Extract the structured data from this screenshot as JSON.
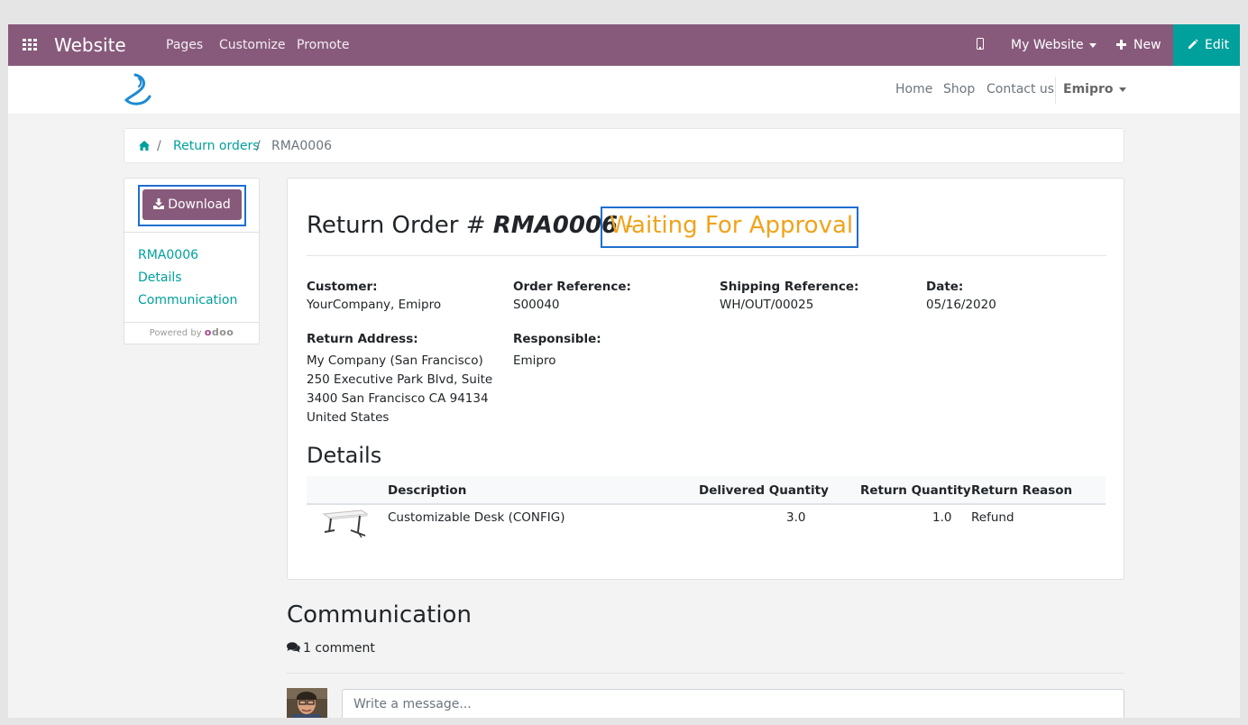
{
  "topbar": {
    "app_title": "Website",
    "menu": [
      "Pages",
      "Customize",
      "Promote"
    ],
    "website_selector": "My Website",
    "new_label": "New",
    "edit_label": "Edit"
  },
  "site_nav": {
    "items": [
      "Home",
      "Shop",
      "Contact us"
    ],
    "user": "Emipro"
  },
  "breadcrumb": {
    "link": "Return orders",
    "current": "RMA0006"
  },
  "sidebar": {
    "download_label": "Download",
    "links": [
      "RMA0006",
      "Details",
      "Communication"
    ],
    "powered_by": "Powered by",
    "brand": "odoo"
  },
  "order": {
    "title_prefix": "Return Order #",
    "number": "RMA0006",
    "separator": "-",
    "status": "Waiting For Approval",
    "fields": {
      "customer_label": "Customer:",
      "customer": "YourCompany, Emipro",
      "order_ref_label": "Order Reference:",
      "order_ref": "S00040",
      "shipping_ref_label": "Shipping Reference:",
      "shipping_ref": "WH/OUT/00025",
      "date_label": "Date:",
      "date": "05/16/2020",
      "return_address_label": "Return Address:",
      "return_address": [
        "My Company (San Francisco)",
        "250 Executive Park Blvd, Suite",
        "3400 San Francisco CA 94134",
        "United States"
      ],
      "responsible_label": "Responsible:",
      "responsible": "Emipro"
    }
  },
  "details": {
    "heading": "Details",
    "columns": [
      "Description",
      "Delivered Quantity",
      "Return Quantity",
      "Return Reason"
    ],
    "rows": [
      {
        "description": "Customizable Desk (CONFIG)",
        "delivered": "3.0",
        "returned": "1.0",
        "reason": "Refund"
      }
    ]
  },
  "communication": {
    "heading": "Communication",
    "comment_count": "1 comment",
    "input_placeholder": "Write a message..."
  },
  "colors": {
    "topbar": "#875a7b",
    "edit_button": "#00a09d",
    "link": "#00a09d",
    "status": "#f0a31c",
    "highlight_box": "#1f6fd0"
  }
}
